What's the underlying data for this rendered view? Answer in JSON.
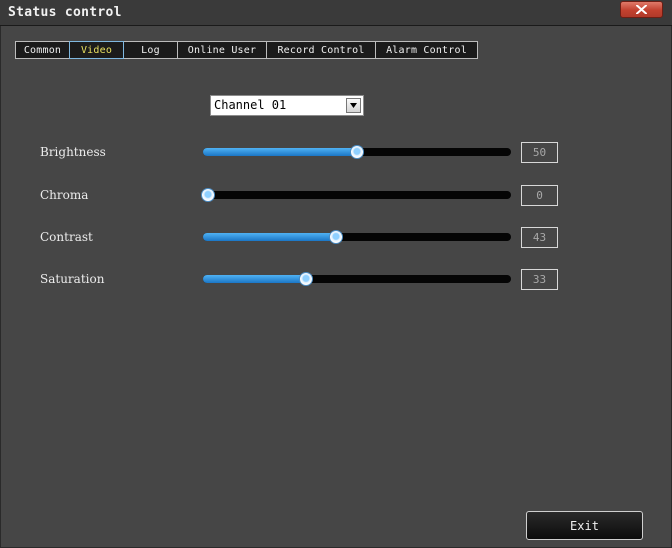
{
  "window": {
    "title": "Status control"
  },
  "tabs": [
    {
      "label": "Common",
      "active": false
    },
    {
      "label": "Video",
      "active": true
    },
    {
      "label": "Log",
      "active": false
    },
    {
      "label": "Online User",
      "active": false
    },
    {
      "label": "Record Control",
      "active": false
    },
    {
      "label": "Alarm Control",
      "active": false
    }
  ],
  "channel": {
    "selected": "Channel 01"
  },
  "sliders": [
    {
      "label": "Brightness",
      "value": "50",
      "fraction": 0.5
    },
    {
      "label": "Chroma",
      "value": "0",
      "fraction": 0.0
    },
    {
      "label": "Contrast",
      "value": "43",
      "fraction": 0.43
    },
    {
      "label": "Saturation",
      "value": "33",
      "fraction": 0.33
    }
  ],
  "footer": {
    "exit_label": "Exit"
  },
  "colors": {
    "accent": "#2a8ee0",
    "background": "#464646",
    "active_tab_text": "#e8e060"
  }
}
